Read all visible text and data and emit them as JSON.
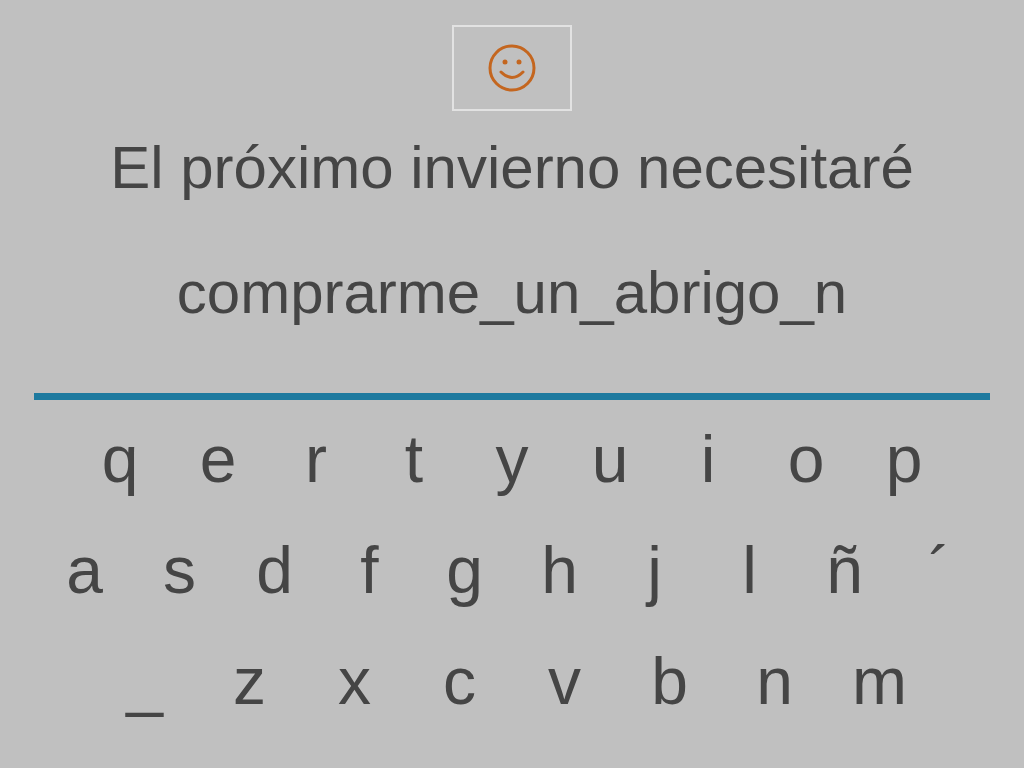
{
  "sentence": "El próximo invierno necesitaré",
  "answer": "comprarme_un_abrigo_n",
  "keyboard": [
    [
      "q",
      "e",
      "r",
      "t",
      "y",
      "u",
      "i",
      "o",
      "p"
    ],
    [
      "a",
      "s",
      "d",
      "f",
      "g",
      "h",
      "j",
      "l",
      "ñ",
      "´"
    ],
    [
      "_",
      "z",
      "x",
      "c",
      "v",
      "b",
      "n",
      "m"
    ]
  ]
}
